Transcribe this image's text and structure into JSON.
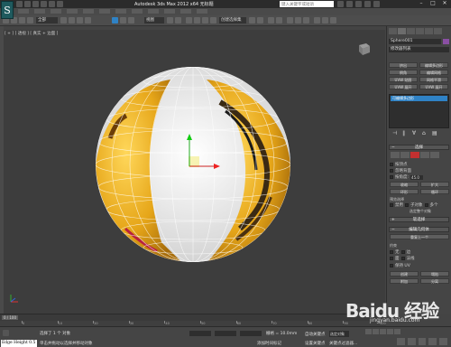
{
  "app": {
    "logo": "S",
    "title": "Autodesk 3ds Max  2012 x64     无标题",
    "search_placeholder": "键入关键字或短语"
  },
  "toolbar": {
    "selection_filter": "全部",
    "view_dropdown": "视图",
    "named_set": "创建选择集"
  },
  "viewport": {
    "label": "[ + ] [ 透视 ] [ 真实 + 边面 ]"
  },
  "command_panel": {
    "object_name": "Sphere001",
    "modifier_list": "修改器列表",
    "buttons": [
      "挤出",
      "编辑多边形",
      "倒角",
      "编辑网格",
      "UVW 贴图",
      "网格平滑",
      "UVW 展开",
      "UVW 展开"
    ],
    "stack_item": "可编辑多边形",
    "selection_rollout": "选择",
    "by_vertex": "按顶点",
    "ignore_backfacing": "忽略背面",
    "by_angle": "按角度:",
    "by_angle_value": "45.0",
    "shrink": "收缩",
    "grow": "扩大",
    "ring": "环形",
    "loop": "循环",
    "preview_selection": "预览选择",
    "preview_options": [
      "禁用",
      "子对象",
      "多个"
    ],
    "selected_status": "选定整个对象",
    "soft_selection": "软选择",
    "edit_geometry": "编辑几何体",
    "repeat_last": "重复上一个",
    "constraints": "约束",
    "constraint_options": [
      "无",
      "边",
      "面",
      "法线"
    ],
    "preserve_uvs": "保持 UV",
    "create": "创建",
    "collapse": "塌陷",
    "attach": "附加",
    "detach": "分离"
  },
  "timeline": {
    "slider": "0 / 100",
    "ticks": [
      "0",
      "10",
      "20",
      "30",
      "40",
      "50",
      "60",
      "70",
      "80",
      "90",
      "100"
    ]
  },
  "statusbar": {
    "maxscript": "Edge Height 0.5",
    "selection_count": "选择了 1 个 对象",
    "prompt": "单击并拖动以选择并移动对象",
    "x_value": "",
    "y_value": "",
    "z_value": "",
    "grid": "栅格 = 10.0mm",
    "auto_key": "自动关键点",
    "set_key": "设置关键点",
    "selected": "选定对象",
    "key_filters": "关键点过滤器...",
    "add_time_tag": "添加时间标记"
  },
  "watermark": {
    "main": "Baidu 经验",
    "sub": "jingyan.baidu.com"
  },
  "colors": {
    "accent_blue": "#2f82c5",
    "sphere_yellow": "#e6a619",
    "object_color": "#8a4fa3"
  }
}
